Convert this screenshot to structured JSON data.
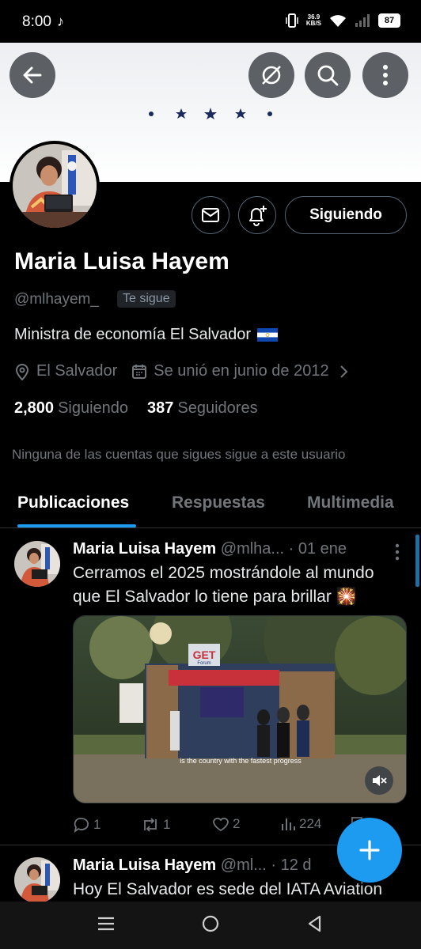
{
  "status_bar": {
    "time": "8:00",
    "tiktok_icon": "♪",
    "net_speed_value": "36.9",
    "net_speed_unit": "KB/S",
    "battery": "87"
  },
  "profile": {
    "name": "Maria Luisa Hayem",
    "handle": "@mlhayem_",
    "follows_you": "Te sigue",
    "bio": "Ministra de economía El Salvador",
    "location": "El Salvador",
    "joined": "Se unió en junio de 2012",
    "following_count": "2,800",
    "following_label": "Siguiendo",
    "followers_count": "387",
    "followers_label": "Seguidores",
    "mutual_note": "Ninguna de las cuentas que sigues sigue a este usuario",
    "follow_button": "Siguiendo"
  },
  "tabs": [
    {
      "label": "Publicaciones",
      "active": true
    },
    {
      "label": "Respuestas",
      "active": false
    },
    {
      "label": "Multimedia",
      "active": false
    }
  ],
  "tweets": [
    {
      "name": "Maria Luisa Hayem",
      "handle": "@mlha...",
      "date": "· 01 ene",
      "text_line1": "Cerramos el 2025 mostrándole al mundo",
      "text_line2": "que El Salvador lo tiene para brillar",
      "emoji": "🎇",
      "video_sign": "GET",
      "video_sign_sub": "Forum",
      "video_caption": "is the country with the fastest progress",
      "replies": "1",
      "reposts": "1",
      "likes": "2",
      "views": "224"
    },
    {
      "name": "Maria Luisa Hayem",
      "handle": "@ml...",
      "date": "· 12 d",
      "text_line1": "Hoy El Salvador es sede del IATA Aviation"
    }
  ],
  "colors": {
    "accent": "#1d9bf0",
    "background": "#000000",
    "secondary_text": "#71767b",
    "flag_blue": "#0f47af"
  }
}
